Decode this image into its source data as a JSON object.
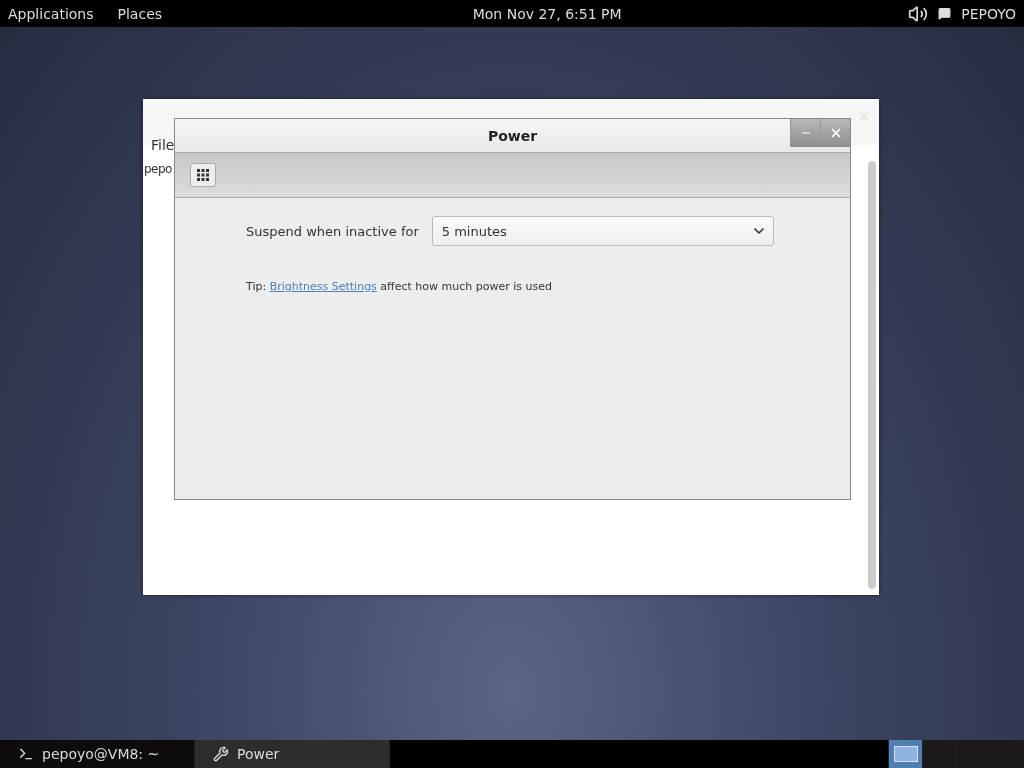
{
  "top_bar": {
    "menus": [
      "Applications",
      "Places"
    ],
    "clock": "Mon Nov 27,  6:51 PM",
    "user": "PEPOYO"
  },
  "terminal": {
    "menu": "File",
    "text": "pepo"
  },
  "dialog": {
    "title": "Power",
    "setting": {
      "label": "Suspend when inactive for",
      "value": "5 minutes"
    },
    "tip": {
      "prefix": "Tip:",
      "link": "Brightness Settings",
      "suffix": "affect how much power is used"
    }
  },
  "taskbar": {
    "items": [
      {
        "label": "pepoyo@VM8: ~",
        "kind": "terminal",
        "selected": false
      },
      {
        "label": "Power",
        "kind": "settings",
        "selected": true
      }
    ],
    "workspaces": [
      {
        "selected": true
      },
      {
        "selected": false
      },
      {
        "selected": false
      },
      {
        "selected": false
      }
    ]
  }
}
